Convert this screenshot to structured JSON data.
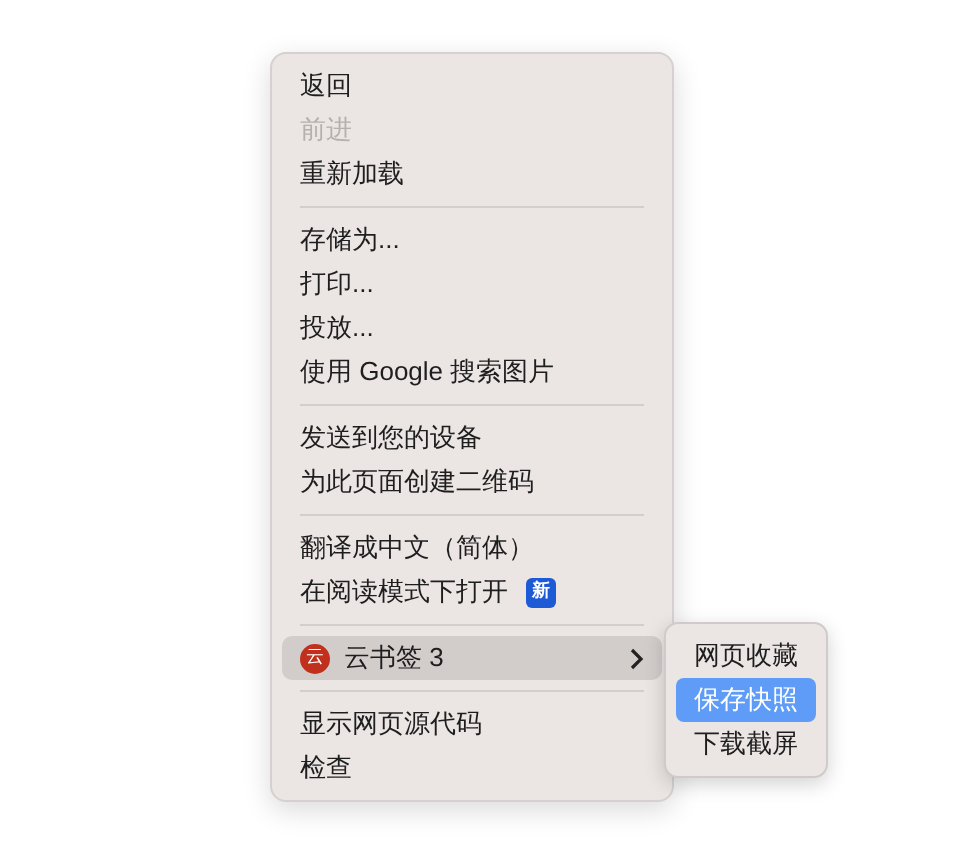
{
  "menu": {
    "groups": [
      {
        "items": [
          {
            "kind": "item",
            "label": "返回",
            "disabled": false
          },
          {
            "kind": "item",
            "label": "前进",
            "disabled": true
          },
          {
            "kind": "item",
            "label": "重新加载",
            "disabled": false
          }
        ]
      },
      {
        "items": [
          {
            "kind": "item",
            "label": "存储为...",
            "disabled": false
          },
          {
            "kind": "item",
            "label": "打印...",
            "disabled": false
          },
          {
            "kind": "item",
            "label": "投放...",
            "disabled": false
          },
          {
            "kind": "item",
            "label": "使用 Google 搜索图片",
            "disabled": false
          }
        ]
      },
      {
        "items": [
          {
            "kind": "item",
            "label": "发送到您的设备",
            "disabled": false
          },
          {
            "kind": "item",
            "label": "为此页面创建二维码",
            "disabled": false
          }
        ]
      },
      {
        "items": [
          {
            "kind": "item",
            "label": "翻译成中文（简体）",
            "disabled": false
          },
          {
            "kind": "badge",
            "label": "在阅读模式下打开",
            "badge": "新",
            "disabled": false
          }
        ]
      },
      {
        "items": [
          {
            "kind": "submenu",
            "label": "云书签 3",
            "logo": "云",
            "selected": true,
            "disabled": false,
            "submenu": [
              {
                "label": "网页收藏",
                "selected": false
              },
              {
                "label": "保存快照",
                "selected": true
              },
              {
                "label": "下载截屏",
                "selected": false
              }
            ]
          }
        ]
      },
      {
        "items": [
          {
            "kind": "item",
            "label": "显示网页源代码",
            "disabled": false
          },
          {
            "kind": "item",
            "label": "检查",
            "disabled": false
          }
        ]
      }
    ]
  }
}
